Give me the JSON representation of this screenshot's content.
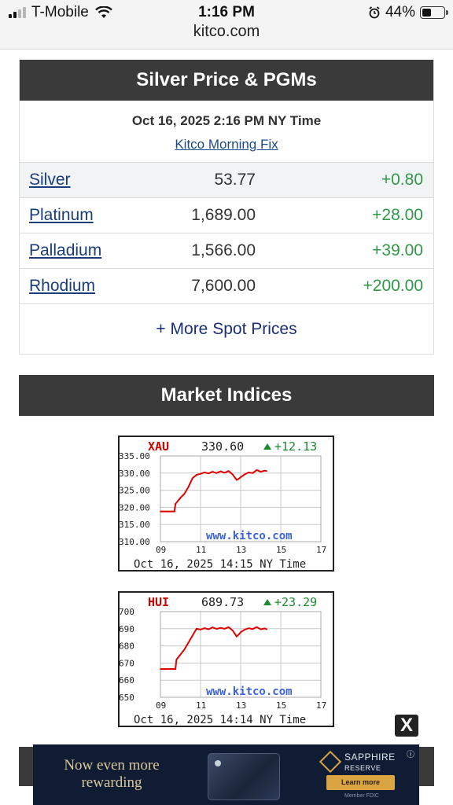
{
  "status_bar": {
    "carrier": "T-Mobile",
    "time": "1:16 PM",
    "url": "kitco.com",
    "battery": "44%",
    "battery_level": 0.44
  },
  "silver_panel": {
    "title": "Silver Price & PGMs",
    "timestamp": "Oct 16, 2025 2:16 PM NY Time",
    "fix_link": "Kitco Morning Fix",
    "rows": [
      {
        "name": "Silver",
        "price": "53.77",
        "change": "+0.80"
      },
      {
        "name": "Platinum",
        "price": "1,689.00",
        "change": "+28.00"
      },
      {
        "name": "Palladium",
        "price": "1,566.00",
        "change": "+39.00"
      },
      {
        "name": "Rhodium",
        "price": "7,600.00",
        "change": "+200.00"
      }
    ],
    "more_link": "+ More Spot Prices"
  },
  "indices": {
    "title": "Market Indices"
  },
  "chart_data": [
    {
      "type": "line",
      "title": "XAU",
      "value": "330.60",
      "change": "+12.13",
      "y_ticks": [
        "335.00",
        "330.00",
        "325.00",
        "320.00",
        "315.00",
        "310.00"
      ],
      "x_ticks": [
        "09",
        "11",
        "13",
        "15",
        "17"
      ],
      "ylim": [
        310,
        335
      ],
      "xlim": [
        9,
        17
      ],
      "watermark": "www.kitco.com",
      "footer": "Oct 16, 2025 14:15 NY Time",
      "line_color": "#e00000",
      "x": [
        9.0,
        9.7,
        9.75,
        10.0,
        10.2,
        10.4,
        10.6,
        10.8,
        11.0,
        11.2,
        11.4,
        11.6,
        11.8,
        12.0,
        12.2,
        12.4,
        12.6,
        12.8,
        12.9,
        13.0,
        13.2,
        13.4,
        13.6,
        13.8,
        14.0,
        14.2,
        14.3
      ],
      "y": [
        318.8,
        318.8,
        321.0,
        322.8,
        324.0,
        326.0,
        328.5,
        329.5,
        329.8,
        330.2,
        329.9,
        330.4,
        330.0,
        330.5,
        330.1,
        330.6,
        329.6,
        328.0,
        328.3,
        328.8,
        329.6,
        330.2,
        330.0,
        330.9,
        330.4,
        330.7,
        330.6
      ]
    },
    {
      "type": "line",
      "title": "HUI",
      "value": "689.73",
      "change": "+23.29",
      "y_ticks": [
        "700",
        "690",
        "680",
        "670",
        "660",
        "650"
      ],
      "x_ticks": [
        "09",
        "11",
        "13",
        "15",
        "17"
      ],
      "ylim": [
        650,
        700
      ],
      "xlim": [
        9,
        17
      ],
      "watermark": "www.kitco.com",
      "footer": "Oct 16, 2025 14:14 NY Time",
      "line_color": "#e00000",
      "x": [
        9.0,
        9.75,
        9.8,
        10.0,
        10.2,
        10.4,
        10.6,
        10.8,
        11.0,
        11.2,
        11.4,
        11.6,
        11.8,
        12.0,
        12.2,
        12.4,
        12.6,
        12.8,
        12.9,
        13.0,
        13.2,
        13.4,
        13.6,
        13.8,
        14.0,
        14.2,
        14.3
      ],
      "y": [
        666.5,
        666.5,
        672.0,
        675.0,
        678.0,
        682.0,
        686.0,
        690.0,
        689.5,
        690.3,
        689.7,
        690.8,
        689.9,
        690.5,
        690.0,
        690.9,
        689.0,
        685.5,
        686.5,
        688.0,
        689.5,
        690.3,
        689.8,
        691.0,
        689.7,
        690.2,
        689.7
      ]
    }
  ],
  "ad": {
    "headline_line1": "Now even more",
    "headline_line2": "rewarding",
    "brand_line1": "SAPPHIRE",
    "brand_line2": "RESERVE",
    "cta": "Learn more",
    "fine_print": "Member FDIC",
    "close_label": "X"
  }
}
